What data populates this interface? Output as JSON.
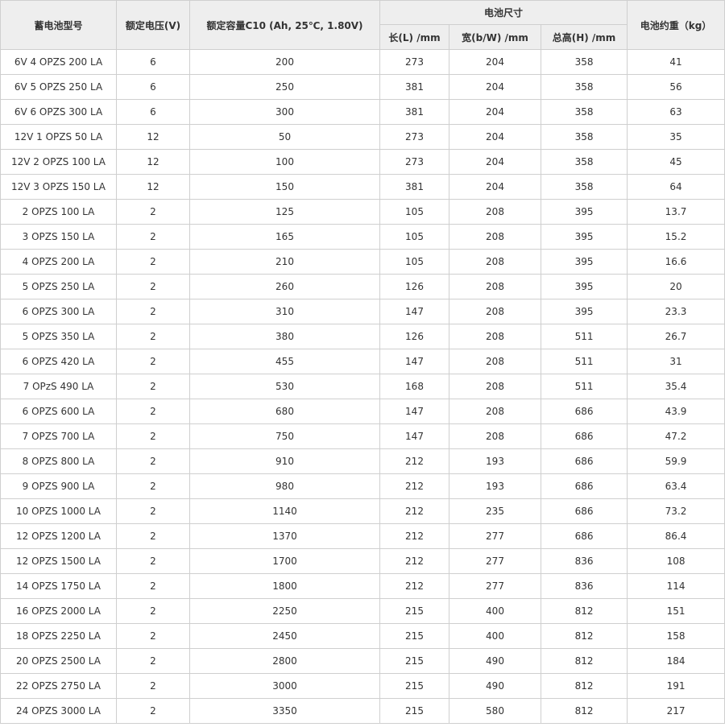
{
  "table": {
    "headers": {
      "model": "蓄电池型号",
      "voltage": "额定电压(V)",
      "capacity": "额定容量C10 (Ah, 25℃, 1.80V)",
      "dimensions": "电池尺寸",
      "length": "长(L) /mm",
      "width": "宽(b/W) /mm",
      "height": "总高(H) /mm",
      "weight": "电池约重（kg）"
    },
    "rows": [
      [
        "6V 4 OPZS 200 LA",
        "6",
        "200",
        "273",
        "204",
        "358",
        "41"
      ],
      [
        "6V 5 OPZS 250 LA",
        "6",
        "250",
        "381",
        "204",
        "358",
        "56"
      ],
      [
        "6V 6 OPZS 300 LA",
        "6",
        "300",
        "381",
        "204",
        "358",
        "63"
      ],
      [
        "12V 1 OPZS 50 LA",
        "12",
        "50",
        "273",
        "204",
        "358",
        "35"
      ],
      [
        "12V 2 OPZS 100 LA",
        "12",
        "100",
        "273",
        "204",
        "358",
        "45"
      ],
      [
        "12V 3 OPZS 150 LA",
        "12",
        "150",
        "381",
        "204",
        "358",
        "64"
      ],
      [
        "2 OPZS 100 LA",
        "2",
        "125",
        "105",
        "208",
        "395",
        "13.7"
      ],
      [
        "3 OPZS 150 LA",
        "2",
        "165",
        "105",
        "208",
        "395",
        "15.2"
      ],
      [
        "4 OPZS 200 LA",
        "2",
        "210",
        "105",
        "208",
        "395",
        "16.6"
      ],
      [
        "5 OPZS 250 LA",
        "2",
        "260",
        "126",
        "208",
        "395",
        "20"
      ],
      [
        "6 OPZS 300 LA",
        "2",
        "310",
        "147",
        "208",
        "395",
        "23.3"
      ],
      [
        "5 OPZS 350 LA",
        "2",
        "380",
        "126",
        "208",
        "511",
        "26.7"
      ],
      [
        "6 OPZS 420 LA",
        "2",
        "455",
        "147",
        "208",
        "511",
        "31"
      ],
      [
        "7 OPzS 490 LA",
        "2",
        "530",
        "168",
        "208",
        "511",
        "35.4"
      ],
      [
        "6 OPZS 600 LA",
        "2",
        "680",
        "147",
        "208",
        "686",
        "43.9"
      ],
      [
        "7 OPZS 700 LA",
        "2",
        "750",
        "147",
        "208",
        "686",
        "47.2"
      ],
      [
        "8 OPZS 800 LA",
        "2",
        "910",
        "212",
        "193",
        "686",
        "59.9"
      ],
      [
        "9 OPZS 900 LA",
        "2",
        "980",
        "212",
        "193",
        "686",
        "63.4"
      ],
      [
        "10 OPZS 1000 LA",
        "2",
        "1140",
        "212",
        "235",
        "686",
        "73.2"
      ],
      [
        "12 OPZS 1200 LA",
        "2",
        "1370",
        "212",
        "277",
        "686",
        "86.4"
      ],
      [
        "12 OPZS 1500 LA",
        "2",
        "1700",
        "212",
        "277",
        "836",
        "108"
      ],
      [
        "14 OPZS 1750 LA",
        "2",
        "1800",
        "212",
        "277",
        "836",
        "114"
      ],
      [
        "16 OPZS 2000 LA",
        "2",
        "2250",
        "215",
        "400",
        "812",
        "151"
      ],
      [
        "18 OPZS 2250 LA",
        "2",
        "2450",
        "215",
        "400",
        "812",
        "158"
      ],
      [
        "20 OPZS 2500 LA",
        "2",
        "2800",
        "215",
        "490",
        "812",
        "184"
      ],
      [
        "22 OPZS 2750 LA",
        "2",
        "3000",
        "215",
        "490",
        "812",
        "191"
      ],
      [
        "24 OPZS 3000 LA",
        "2",
        "3350",
        "215",
        "580",
        "812",
        "217"
      ]
    ]
  }
}
